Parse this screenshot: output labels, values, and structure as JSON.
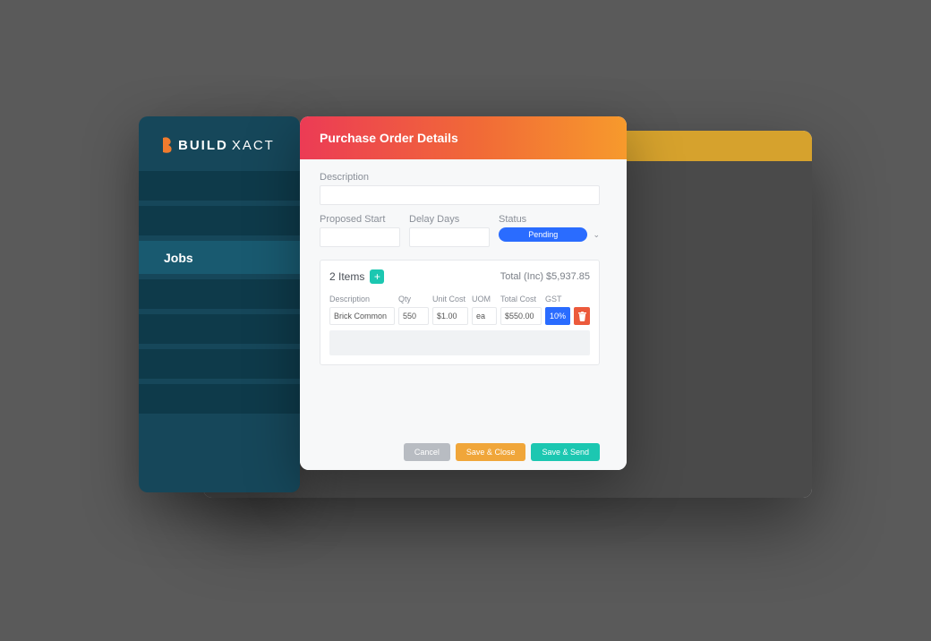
{
  "brand": {
    "prefix": "BUILD",
    "suffix": "XACT"
  },
  "sidebar": {
    "active_label": "Jobs"
  },
  "modal": {
    "title": "Purchase Order Details",
    "labels": {
      "description": "Description",
      "proposed_start": "Proposed Start",
      "delay_days": "Delay Days",
      "status": "Status"
    },
    "fields": {
      "description": "",
      "proposed_start": "",
      "delay_days": "",
      "status_value": "Pending"
    },
    "items": {
      "count_label": "2 Items",
      "total_label": "Total (Inc) $5,937.85",
      "columns": {
        "description": "Description",
        "qty": "Qty",
        "unit_cost": "Unit Cost",
        "uom": "UOM",
        "total_cost": "Total Cost",
        "gst": "GST"
      },
      "rows": [
        {
          "description": "Brick Common",
          "qty": "550",
          "unit_cost": "$1.00",
          "uom": "ea",
          "total_cost": "$550.00",
          "gst": "10%"
        }
      ]
    },
    "actions": {
      "cancel": "Cancel",
      "save_close": "Save & Close",
      "save_send": "Save & Send"
    }
  }
}
